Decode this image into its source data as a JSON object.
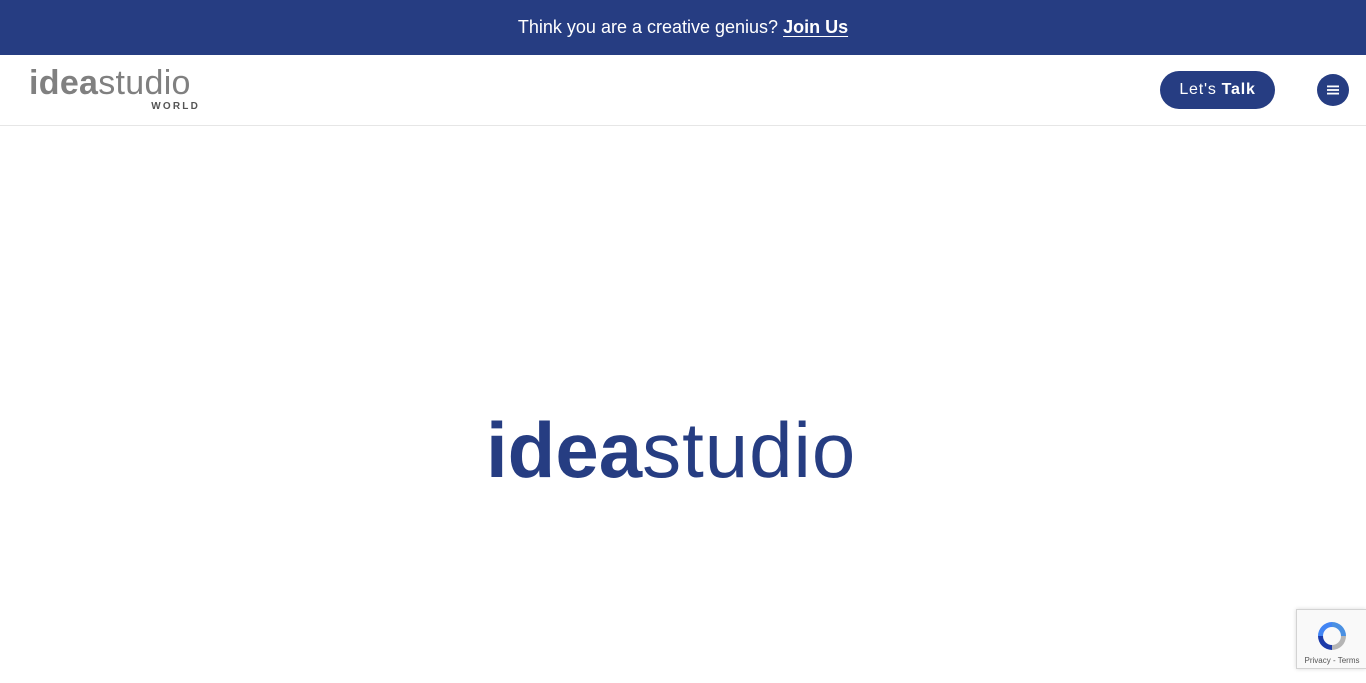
{
  "announcement": {
    "text": "Think you are a creative genius?",
    "link_label": "Join Us"
  },
  "header": {
    "logo_bold": "idea",
    "logo_light": "studio",
    "logo_sub": "WORLD",
    "cta_prefix": "Let's",
    "cta_bold": "Talk",
    "menu_icon": "hamburger-icon"
  },
  "hero": {
    "logo_bold": "idea",
    "logo_light": "studio"
  },
  "recaptcha": {
    "privacy_label": "Privacy",
    "separator": " - ",
    "terms_label": "Terms"
  },
  "colors": {
    "brand": "#263d82",
    "logo_grey": "#808080"
  }
}
